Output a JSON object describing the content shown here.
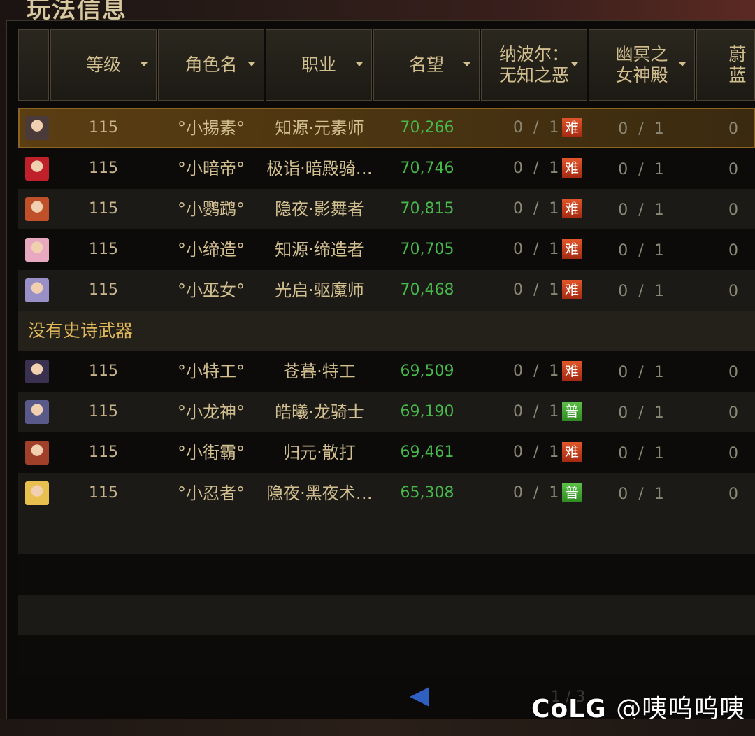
{
  "page_title": "玩法信息",
  "headers": [
    {
      "label": "",
      "sortable": false
    },
    {
      "label": "等级",
      "sortable": true
    },
    {
      "label": "角色名",
      "sortable": true
    },
    {
      "label": "职业",
      "sortable": true
    },
    {
      "label": "名望",
      "sortable": true
    },
    {
      "label": "纳波尔：\n无知之恶",
      "sortable": true
    },
    {
      "label": "幽冥之\n女神殿",
      "sortable": true
    },
    {
      "label": "蔚蓝",
      "sortable": false
    }
  ],
  "groups": [
    {
      "title": "",
      "characters": [
        {
          "level": "115",
          "name": "°小掦素°",
          "class": "知源·元素师",
          "fame": "70,266",
          "p1": "0 / 1",
          "p1_badge": "难",
          "p1_badge_type": "hard",
          "p2": "0 / 1",
          "p3": "0",
          "selected": true,
          "avatar_color": "#4a3a3a"
        },
        {
          "level": "115",
          "name": "°小暗帝°",
          "class": "极诣·暗殿骑…",
          "fame": "70,746",
          "p1": "0 / 1",
          "p1_badge": "难",
          "p1_badge_type": "hard",
          "p2": "0 / 1",
          "p3": "0",
          "selected": false,
          "avatar_color": "#c0202a"
        },
        {
          "level": "115",
          "name": "°小鹦鹉°",
          "class": "隐夜·影舞者",
          "fame": "70,815",
          "p1": "0 / 1",
          "p1_badge": "难",
          "p1_badge_type": "hard",
          "p2": "0 / 1",
          "p3": "0",
          "selected": false,
          "avatar_color": "#c0502a"
        },
        {
          "level": "115",
          "name": "°小缔造°",
          "class": "知源·缔造者",
          "fame": "70,705",
          "p1": "0 / 1",
          "p1_badge": "难",
          "p1_badge_type": "hard",
          "p2": "0 / 1",
          "p3": "0",
          "selected": false,
          "avatar_color": "#e8a8c0"
        },
        {
          "level": "115",
          "name": "°小巫女°",
          "class": "光启·驱魔师",
          "fame": "70,468",
          "p1": "0 / 1",
          "p1_badge": "难",
          "p1_badge_type": "hard",
          "p2": "0 / 1",
          "p3": "0",
          "selected": false,
          "avatar_color": "#9a90c8"
        }
      ]
    },
    {
      "title": "没有史诗武器",
      "characters": [
        {
          "level": "115",
          "name": "°小特工°",
          "class": "苍暮·特工",
          "fame": "69,509",
          "p1": "0 / 1",
          "p1_badge": "难",
          "p1_badge_type": "hard",
          "p2": "0 / 1",
          "p3": "0",
          "selected": false,
          "avatar_color": "#3a3050"
        },
        {
          "level": "115",
          "name": "°小龙神°",
          "class": "皓曦·龙骑士",
          "fame": "69,190",
          "p1": "0 / 1",
          "p1_badge": "普",
          "p1_badge_type": "normal",
          "p2": "0 / 1",
          "p3": "0",
          "selected": false,
          "avatar_color": "#5a5a8a"
        },
        {
          "level": "115",
          "name": "°小街霸°",
          "class": "归元·散打",
          "fame": "69,461",
          "p1": "0 / 1",
          "p1_badge": "难",
          "p1_badge_type": "hard",
          "p2": "0 / 1",
          "p3": "0",
          "selected": false,
          "avatar_color": "#a0402a"
        },
        {
          "level": "115",
          "name": "°小忍者°",
          "class": "隐夜·黑夜术…",
          "fame": "65,308",
          "p1": "0 / 1",
          "p1_badge": "普",
          "p1_badge_type": "normal",
          "p2": "0 / 1",
          "p3": "0",
          "selected": false,
          "avatar_color": "#e8c050"
        }
      ]
    }
  ],
  "pagination": {
    "indicator": "1 / 3"
  },
  "watermark": {
    "brand": "CoLG",
    "handle": "@咦呜呜咦"
  },
  "colors": {
    "fame": "#47b84a",
    "badge_hard": "#c8401c",
    "badge_normal": "#3aa02e",
    "section_title": "#e0b85a",
    "selected_row": "#5b3e12"
  }
}
